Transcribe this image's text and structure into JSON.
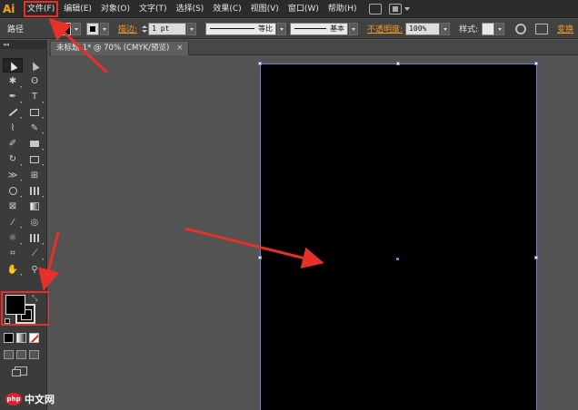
{
  "app": {
    "logo": "Ai"
  },
  "menu": [
    {
      "label": "文件(F)",
      "highlighted": true
    },
    {
      "label": "编辑(E)"
    },
    {
      "label": "对象(O)"
    },
    {
      "label": "文字(T)"
    },
    {
      "label": "选择(S)"
    },
    {
      "label": "效果(C)"
    },
    {
      "label": "视图(V)"
    },
    {
      "label": "窗口(W)"
    },
    {
      "label": "帮助(H)"
    }
  ],
  "control": {
    "selection_label": "路径",
    "stroke_label": "描边:",
    "stroke_weight": "1 pt",
    "profile_uniform": "等比",
    "profile_brush": "基本",
    "opacity_label": "不透明度:",
    "opacity_value": "100%",
    "style_label": "样式:",
    "transform_label": "变换"
  },
  "document": {
    "tab_title": "未标题-1* @ 70% (CMYK/预览)",
    "close_glyph": "×"
  },
  "toolbar": {
    "collapse_glyph": "◂◂",
    "tools": [
      "selection-tool",
      "direct-selection-tool",
      "magic-wand-tool",
      "lasso-tool",
      "pen-tool",
      "type-tool",
      "line-segment-tool",
      "rectangle-tool",
      "paintbrush-tool",
      "pencil-tool",
      "blob-brush-tool",
      "eraser-tool",
      "rotate-tool",
      "scale-tool",
      "width-tool",
      "free-transform-tool",
      "shape-builder-tool",
      "perspective-grid-tool",
      "mesh-tool",
      "gradient-tool",
      "eyedropper-tool",
      "blend-tool",
      "symbol-sprayer-tool",
      "column-graph-tool",
      "artboard-tool",
      "slice-tool",
      "hand-tool",
      "zoom-tool"
    ]
  },
  "colors": {
    "accent_orange": "#f59a23",
    "annotation_red": "#e8302a",
    "selection_blue": "#6a7fe0",
    "artboard_fill": "#000000"
  },
  "watermark": {
    "logo": "php",
    "text": "中文网"
  }
}
